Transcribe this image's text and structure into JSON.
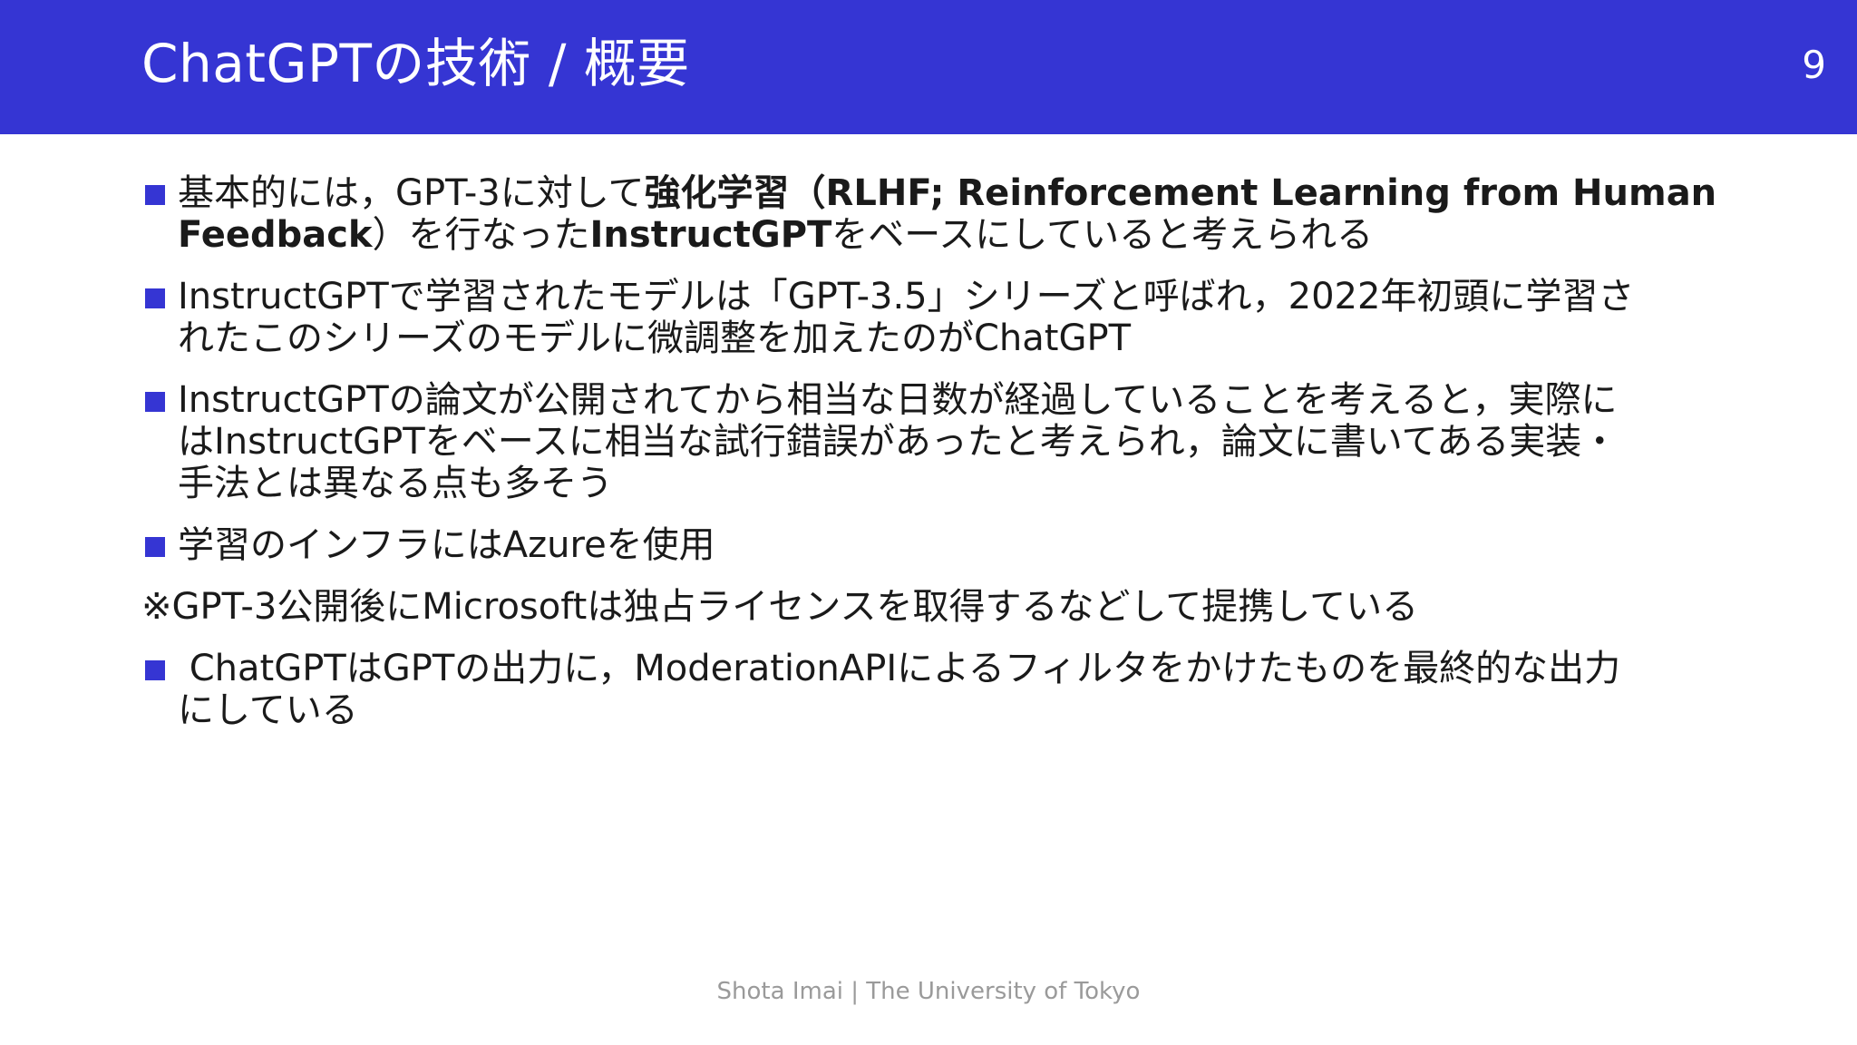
{
  "header": {
    "title": "ChatGPTの技術 / 概要",
    "page_number": "9",
    "bg_color": "#3535d3"
  },
  "bullets": [
    {
      "icon": "square-bullet-icon",
      "line1_a": "基本的には，GPT-3に対して",
      "line1_b": "強化学習（RLHF; Reinforcement Learning from Human",
      "line2_a": "Feedback",
      "line2_b": "）を行なった",
      "line2_c": "InstructGPT",
      "line2_d": "をベースにしていると考えられる"
    },
    {
      "icon": "square-bullet-icon",
      "line1": "InstructGPTで学習されたモデルは「GPT-3.5」シリーズと呼ばれ，2022年初頭に学習さ",
      "line2": "れたこのシリーズのモデルに微調整を加えたのがChatGPT"
    },
    {
      "icon": "square-bullet-icon",
      "line1": "InstructGPTの論文が公開されてから相当な日数が経過していることを考えると，実際に",
      "line2": "はInstructGPTをベースに相当な試行錯誤があったと考えられ，論文に書いてある実装・",
      "line3": "手法とは異なる点も多そう"
    },
    {
      "icon": "square-bullet-icon",
      "line1": "学習のインフラにはAzureを使用"
    },
    {
      "line1": "※GPT-3公開後にMicrosoftは独占ライセンスを取得するなどして提携している"
    },
    {
      "icon": "square-bullet-icon",
      "line1": " ChatGPTはGPTの出力に，ModerationAPIによるフィルタをかけたものを最終的な出力",
      "line2": "にしている"
    }
  ],
  "footer": {
    "text": "Shota Imai | The University of Tokyo"
  }
}
